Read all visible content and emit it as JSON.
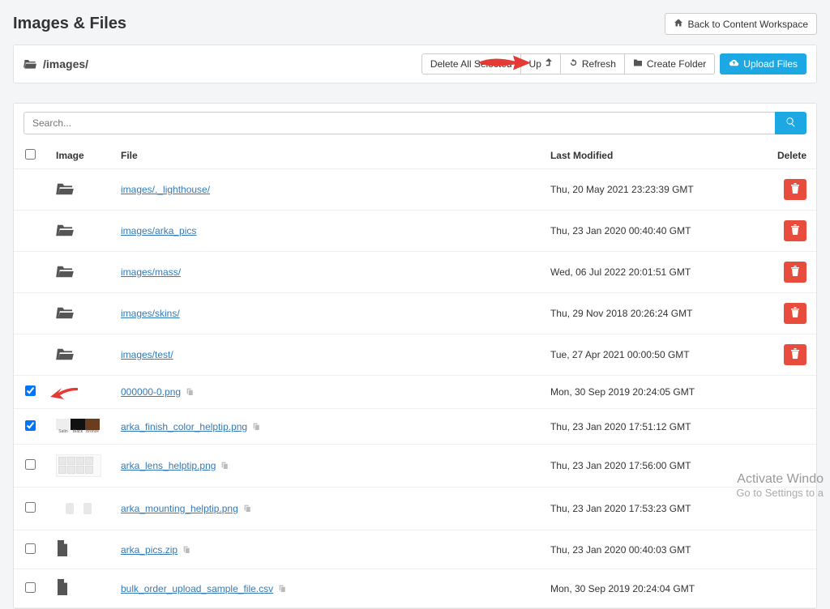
{
  "page_title": "Images & Files",
  "back_button": "Back to Content Workspace",
  "breadcrumb_path": "/images/",
  "toolbar": {
    "delete_selected": "Delete All Selected",
    "up": "Up",
    "refresh": "Refresh",
    "create_folder": "Create Folder",
    "upload": "Upload Files"
  },
  "search": {
    "placeholder": "Search..."
  },
  "columns": {
    "image": "Image",
    "file": "File",
    "modified": "Last Modified",
    "delete": "Delete"
  },
  "rows": [
    {
      "type": "folder",
      "checked": false,
      "name": "images/._lighthouse/",
      "modified": "Thu, 20 May 2021 23:23:39 GMT"
    },
    {
      "type": "folder",
      "checked": false,
      "name": "images/arka_pics",
      "modified": "Thu, 23 Jan 2020 00:40:40 GMT"
    },
    {
      "type": "folder",
      "checked": false,
      "name": "images/mass/",
      "modified": "Wed, 06 Jul 2022 20:01:51 GMT"
    },
    {
      "type": "folder",
      "checked": false,
      "name": "images/skins/",
      "modified": "Thu, 29 Nov 2018 20:26:24 GMT"
    },
    {
      "type": "folder",
      "checked": false,
      "name": "images/test/",
      "modified": "Tue, 27 Apr 2021 00:00:50 GMT"
    },
    {
      "type": "file",
      "checked": true,
      "thumb": "blank",
      "name": "000000-0.png",
      "modified": "Mon, 30 Sep 2019 20:24:05 GMT",
      "arrow": true
    },
    {
      "type": "file",
      "checked": true,
      "thumb": "swatch",
      "name": "arka_finish_color_helptip.png",
      "modified": "Thu, 23 Jan 2020 17:51:12 GMT"
    },
    {
      "type": "file",
      "checked": false,
      "thumb": "grid",
      "name": "arka_lens_helptip.png",
      "modified": "Thu, 23 Jan 2020 17:56:00 GMT"
    },
    {
      "type": "file",
      "checked": false,
      "thumb": "mount",
      "name": "arka_mounting_helptip.png",
      "modified": "Thu, 23 Jan 2020 17:53:23 GMT"
    },
    {
      "type": "file",
      "checked": false,
      "thumb": "docfile",
      "name": "arka_pics.zip",
      "modified": "Thu, 23 Jan 2020 00:40:03 GMT"
    },
    {
      "type": "file",
      "checked": false,
      "thumb": "docfile",
      "name": "bulk_order_upload_sample_file.csv",
      "modified": "Mon, 30 Sep 2019 20:24:04 GMT"
    }
  ],
  "watermark": {
    "title": "Activate Windo",
    "sub": "Go to Settings to a"
  },
  "swatch_labels": {
    "a": "Satin",
    "b": "Black",
    "c": "Bronze"
  }
}
